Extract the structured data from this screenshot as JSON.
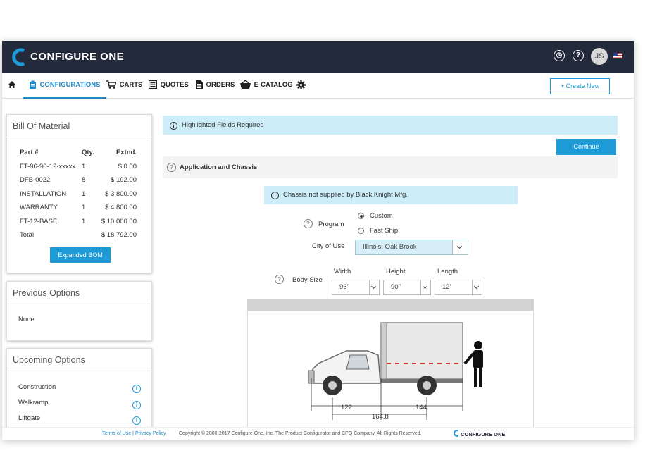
{
  "app": {
    "brand": "CONFIGURE ONE",
    "user_initials": "JS",
    "brand_color": "#232a3c",
    "accent": "#1e9bd7"
  },
  "nav": {
    "items": [
      {
        "label": "CONFIGURATIONS",
        "icon": "clipboard-icon",
        "active": true
      },
      {
        "label": "CARTS",
        "icon": "cart-icon"
      },
      {
        "label": "QUOTES",
        "icon": "list-icon"
      },
      {
        "label": "ORDERS",
        "icon": "document-icon"
      },
      {
        "label": "E-CATALOG",
        "icon": "basket-icon"
      }
    ],
    "create_label": "+ Create New"
  },
  "bom": {
    "title": "Bill Of Material",
    "headers": {
      "part": "Part #",
      "qty": "Qty.",
      "ext": "Extnd."
    },
    "rows": [
      {
        "part": "FT-96-90-12-xxxxx",
        "qty": "1",
        "ext": "$ 0.00"
      },
      {
        "part": "DFB-0022",
        "qty": "8",
        "ext": "$ 192.00"
      },
      {
        "part": "INSTALLATION",
        "qty": "1",
        "ext": "$ 3,800.00"
      },
      {
        "part": "WARRANTY",
        "qty": "1",
        "ext": "$ 4,800.00"
      },
      {
        "part": "FT-12-BASE",
        "qty": "1",
        "ext": "$ 10,000.00"
      }
    ],
    "total_label": "Total",
    "total_value": "$ 18,792.00",
    "expand_label": "Expanded BOM"
  },
  "previous": {
    "title": "Previous Options",
    "value": "None"
  },
  "upcoming": {
    "title": "Upcoming Options",
    "items": [
      "Construction",
      "Walkramp",
      "Liftgate"
    ]
  },
  "main": {
    "required_notice": "Highlighted Fields Required",
    "continue_label": "Continue",
    "section_title": "Application and Chassis",
    "chassis_notice": "Chassis not supplied by Black Knight Mfg.",
    "program_label": "Program",
    "program_options": [
      "Custom",
      "Fast Ship"
    ],
    "city_label": "City of Use",
    "city_value": "Illinois, Oak Brook",
    "body_size_label": "Body Size",
    "width_label": "Width",
    "width_value": "96\"",
    "height_label": "Height",
    "height_value": "90\"",
    "length_label": "Length",
    "length_value": "12'",
    "dim_a": "122",
    "dim_b": "164.8",
    "dim_c": "144"
  },
  "footer": {
    "terms": "Terms of Use",
    "sep": " | ",
    "privacy": "Privacy Policy",
    "copyright": "Copyright © 2000-2017 Configure One, Inc. The Product Configurator and CPQ Company. All Rights Reserved.",
    "logo_text": "CONFIGURE ONE"
  }
}
